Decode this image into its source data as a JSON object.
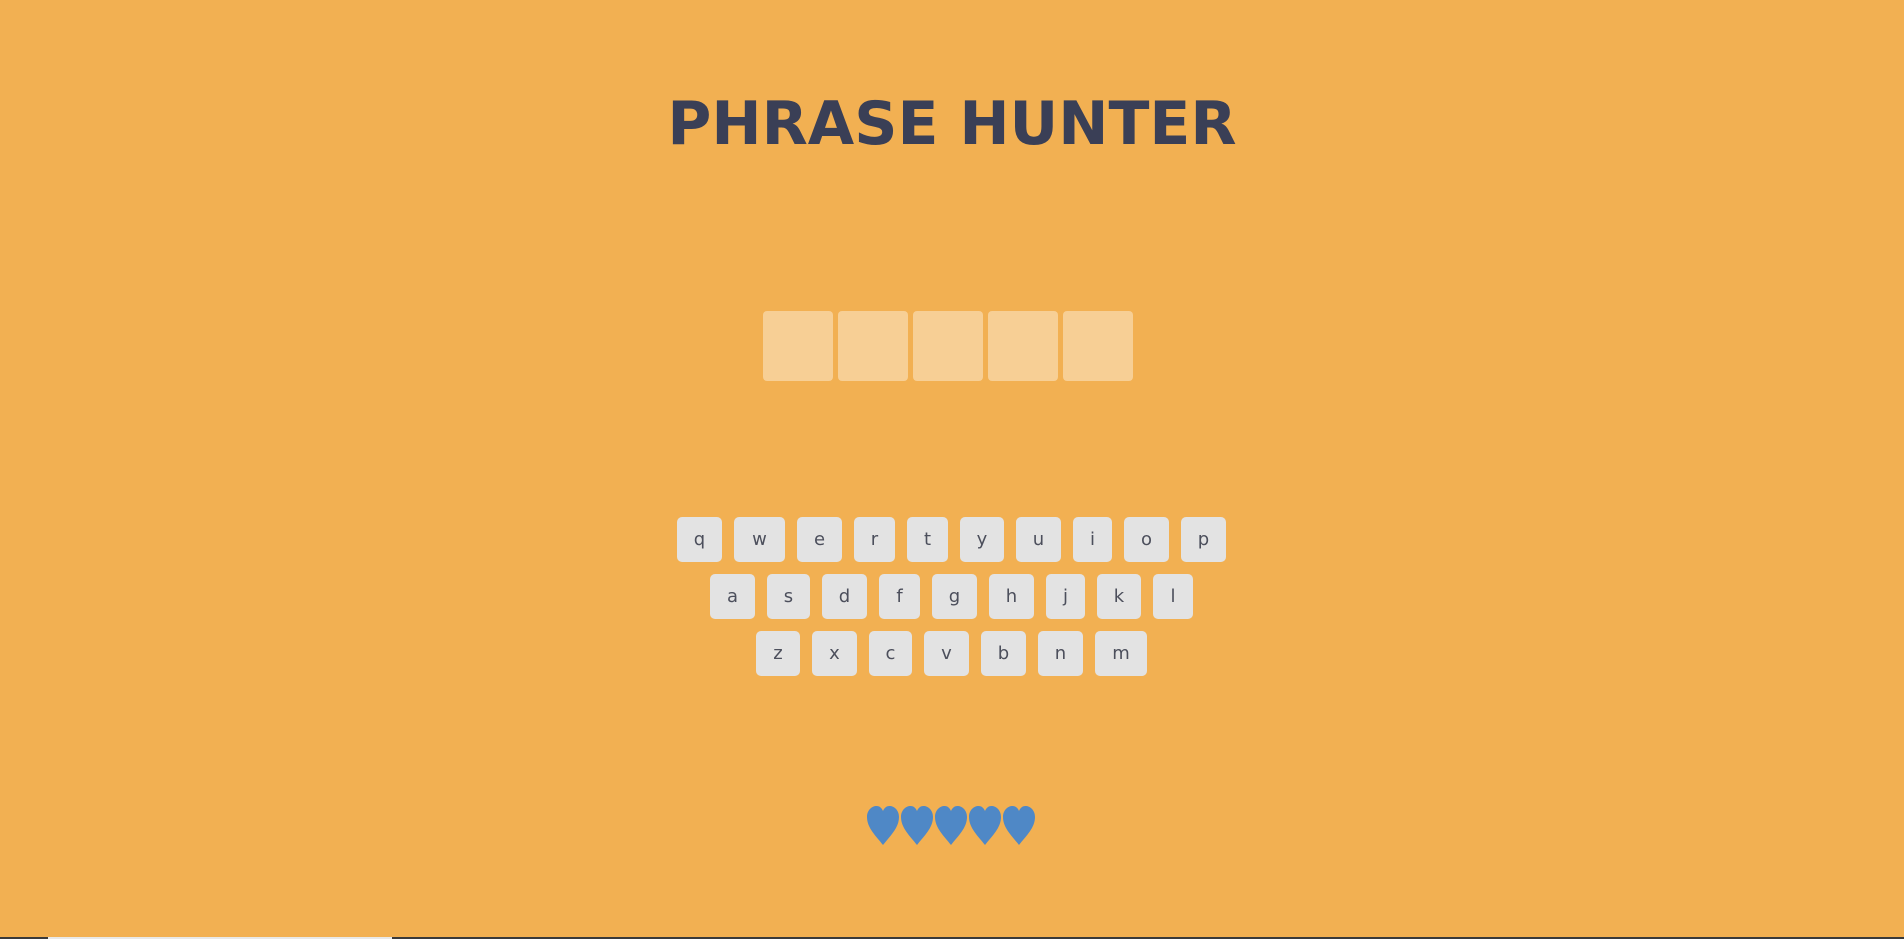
{
  "header": {
    "title": "PHRASE HUNTER"
  },
  "phrase": {
    "tile_count": 5,
    "tile_color": "#f7cf95"
  },
  "keyboard": {
    "rows": [
      [
        "q",
        "w",
        "e",
        "r",
        "t",
        "y",
        "u",
        "i",
        "o",
        "p"
      ],
      [
        "a",
        "s",
        "d",
        "f",
        "g",
        "h",
        "j",
        "k",
        "l"
      ],
      [
        "z",
        "x",
        "c",
        "v",
        "b",
        "n",
        "m"
      ]
    ],
    "key_color": "#e3e3e3"
  },
  "lives": {
    "count": 5,
    "icon": "heart-icon",
    "color": "#4f88c6"
  },
  "colors": {
    "background": "#f2b052",
    "title": "#3a3f56"
  }
}
